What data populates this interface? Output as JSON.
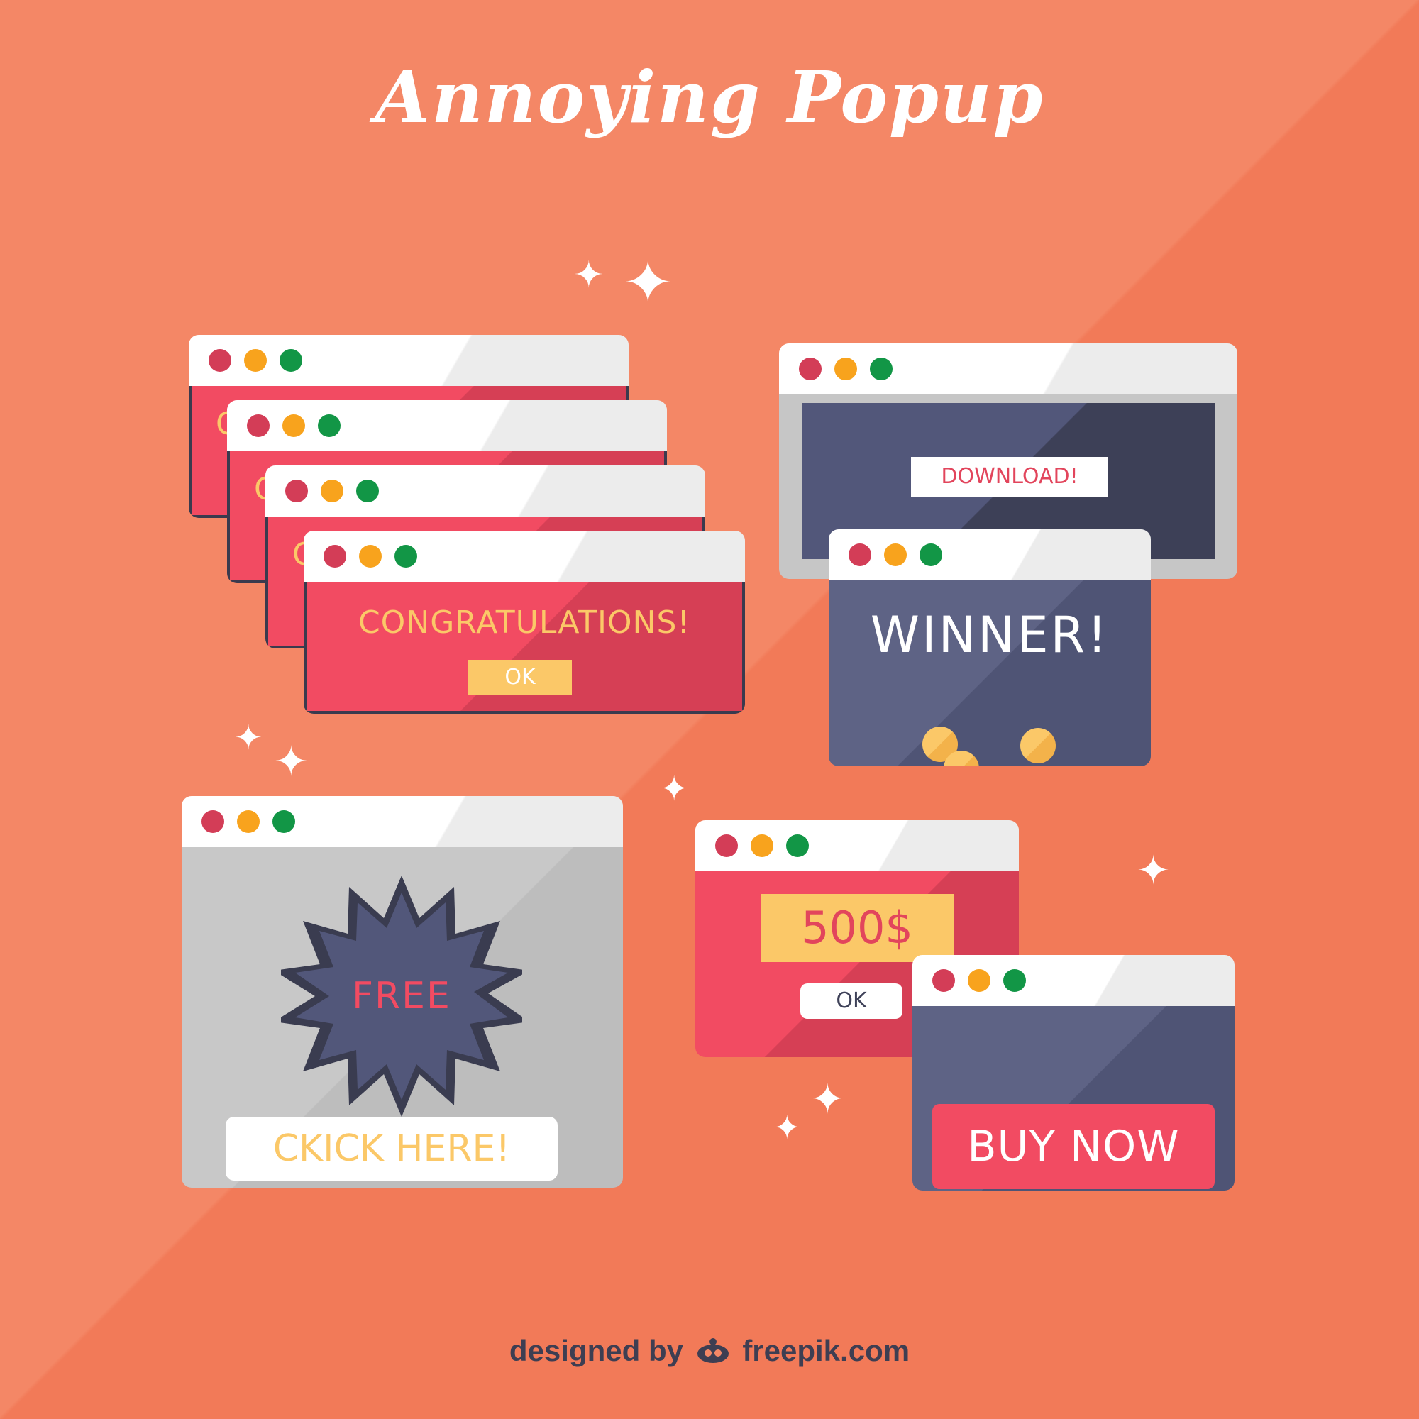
{
  "title": "Annoying Popup",
  "stack": {
    "message": "CONGRATULATIONS!",
    "ok_label": "OK",
    "peek_letter": "C"
  },
  "download_popup": {
    "label": "DOWNLOAD!"
  },
  "winner_popup": {
    "label": "WINNER!"
  },
  "free_popup": {
    "badge": "FREE",
    "button_label": "CKICK HERE!"
  },
  "money_popup": {
    "amount": "500$",
    "ok_label": "OK"
  },
  "buy_popup": {
    "button_label": "BUY NOW"
  },
  "credit": {
    "prefix": "designed by",
    "site": "freepik.com"
  },
  "colors": {
    "background": "#f48766",
    "red": "#f24b62",
    "navy": "#4f5475",
    "gray": "#c8c8c8",
    "yellow": "#fbc868",
    "dot_red": "#d33d57",
    "dot_yellow": "#f8a31d",
    "dot_green": "#129646"
  },
  "icons": [
    "sparkle-icon",
    "coin-icon",
    "window-dot-icon",
    "starburst-badge-icon",
    "freepik-logo-icon"
  ]
}
